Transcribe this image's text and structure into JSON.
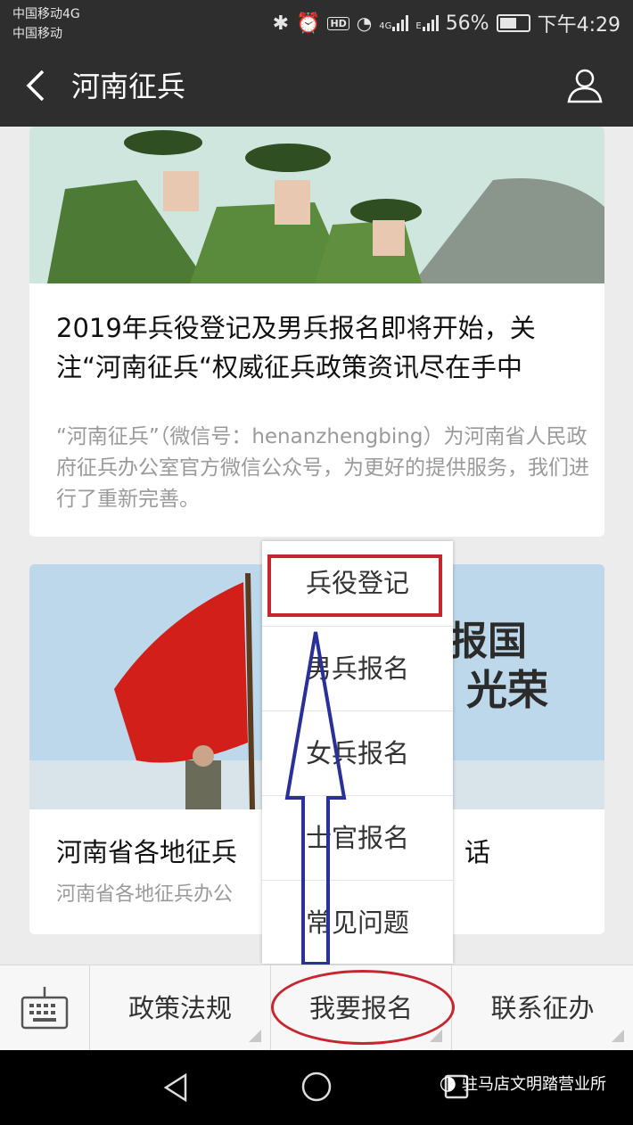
{
  "statusbar": {
    "carrier_line1": "中国移动4G",
    "carrier_line2": "中国移动",
    "network_4g": "4G",
    "network_e": "E",
    "battery": "56%",
    "time": "下午4:29",
    "hd_label": "HD"
  },
  "navbar": {
    "title": "河南征兵"
  },
  "articles": [
    {
      "title": "2019年兵役登记及男兵报名即将开始，关注“河南征兵“权威征兵政策资讯尽在手中",
      "summary": "“河南征兵”（微信号：henanzhengbing）为河南省人民政府征兵办公室官方微信公众号，为更好的提供服务，我们进行了重新完善。"
    },
    {
      "title": "河南省各地征兵",
      "title_tail": "话",
      "summary": "河南省各地征兵办公"
    }
  ],
  "banner_text": {
    "line1": "报国",
    "line2": "光荣"
  },
  "popup_menu": {
    "items": [
      "兵役登记",
      "男兵报名",
      "女兵报名",
      "士官报名",
      "常见问题"
    ]
  },
  "bottom_menu": {
    "tabs": [
      "政策法规",
      "我要报名",
      "联系征办"
    ]
  },
  "watermark": {
    "text": "驻马店文明踏营业所"
  },
  "annotation_colors": {
    "red": "#c8262e",
    "blue": "#2b2f9a"
  }
}
